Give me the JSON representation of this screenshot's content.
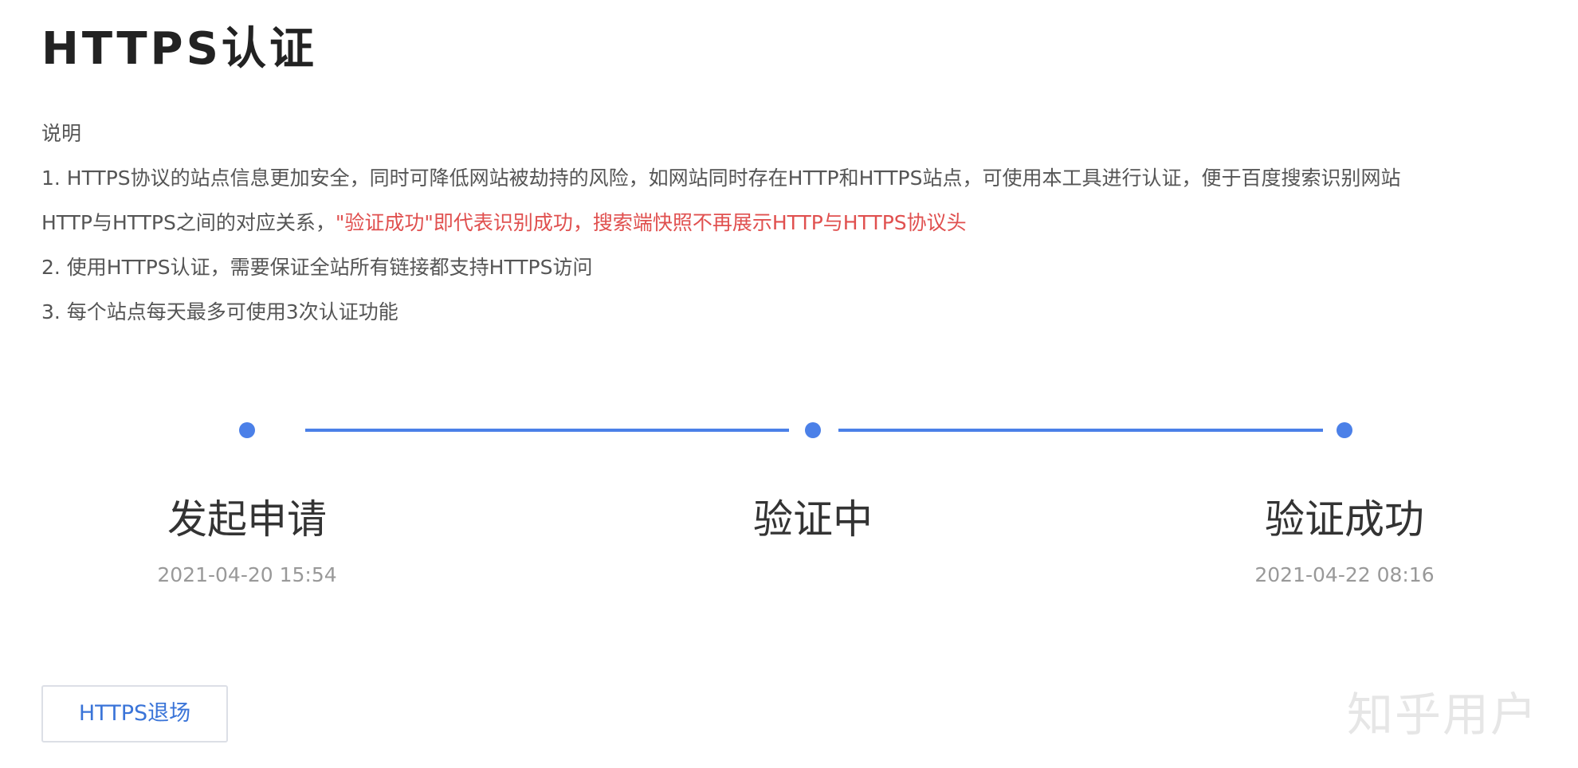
{
  "header": {
    "title": "HTTPS认证"
  },
  "description": {
    "heading": "说明",
    "item1_line1": "1. HTTPS协议的站点信息更加安全，同时可降低网站被劫持的风险，如网站同时存在HTTP和HTTPS站点，可使用本工具进行认证，便于百度搜索识别网站",
    "item1_line2_normal": "HTTP与HTTPS之间的对应关系，",
    "item1_line2_highlight": "\"验证成功\"即代表识别成功，搜索端快照不再展示HTTP与HTTPS协议头",
    "item2": "2. 使用HTTPS认证，需要保证全站所有链接都支持HTTPS访问",
    "item3": "3. 每个站点每天最多可使用3次认证功能",
    "highlight_color": "#e0504f"
  },
  "steps": [
    {
      "label": "发起申请",
      "time": "2021-04-20 15:54"
    },
    {
      "label": "验证中",
      "time": ""
    },
    {
      "label": "验证成功",
      "time": "2021-04-22 08:16"
    }
  ],
  "step_color": "#4b80e8",
  "actions": {
    "exit_label": "HTTPS退场"
  },
  "watermark": {
    "text": "知乎用户"
  }
}
